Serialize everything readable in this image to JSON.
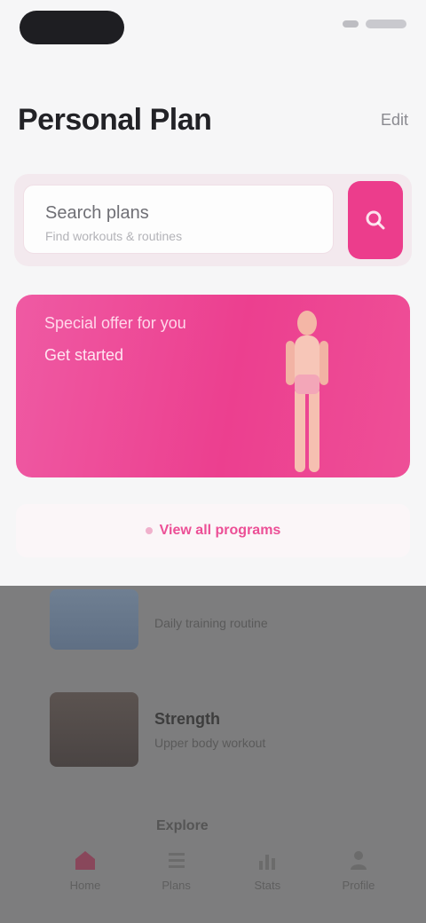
{
  "status_bar": {},
  "header": {
    "title": "Personal Plan",
    "action_label": "Edit"
  },
  "search": {
    "title": "Search plans",
    "subtitle": "Find workouts & routines"
  },
  "promo": {
    "line1": "Special offer for you",
    "line2": "Get started"
  },
  "strip": {
    "label": "View all programs"
  },
  "rows": [
    {
      "title": "",
      "subtitle": "Daily training routine"
    },
    {
      "title": "Strength",
      "subtitle": "Upper body workout"
    }
  ],
  "bottom_nav": {
    "heading": "Explore",
    "items": [
      {
        "label": "Home"
      },
      {
        "label": "Plans"
      },
      {
        "label": "Stats"
      },
      {
        "label": "Profile"
      }
    ]
  },
  "colors": {
    "accent": "#ec3d8c",
    "overlay": "#7d7d7e"
  }
}
